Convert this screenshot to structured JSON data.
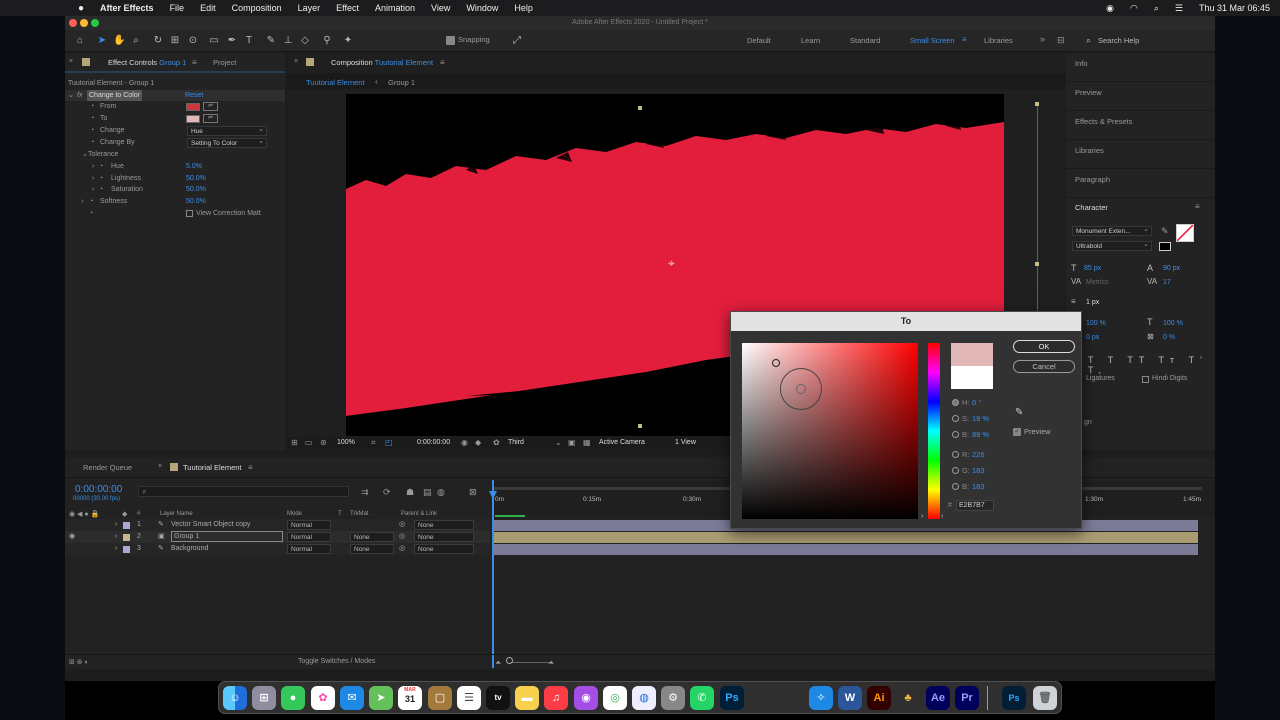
{
  "menubar": {
    "app_name": "After Effects",
    "items": [
      "File",
      "Edit",
      "Composition",
      "Layer",
      "Effect",
      "Animation",
      "View",
      "Window",
      "Help"
    ],
    "clock": "Thu 31 Mar  06:45"
  },
  "window": {
    "title": "Adobe After Effects 2020 - Untitled Project *"
  },
  "toolbar": {
    "snapping_label": "Snapping",
    "workspaces": [
      "Default",
      "Learn",
      "Standard",
      "Small Screen",
      "Libraries"
    ],
    "search_placeholder": "Search Help"
  },
  "effect_controls": {
    "tab_label": "Effect Controls",
    "tab_layer": "Group 1",
    "project_tab": "Project",
    "breadcrumb": "Tuutorial Element - Group 1",
    "effect_name": "Change to Color",
    "reset_label": "Reset",
    "rows": {
      "from": "From",
      "to": "To",
      "change": "Change",
      "change_value": "Hue",
      "change_by": "Change By",
      "change_by_value": "Setting To Color",
      "tolerance": "Tolerance",
      "hue": "Hue",
      "hue_value": "5.0%",
      "lightness": "Lightness",
      "lightness_value": "50.0%",
      "saturation": "Saturation",
      "saturation_value": "50.0%",
      "softness": "Softness",
      "softness_value": "50.0%",
      "view_correction": "View Correction Matt"
    },
    "colors": {
      "from": "#c8383c",
      "to": "#e2b7b7"
    }
  },
  "composition": {
    "tab_prefix": "Composition",
    "tab_name": "Tuutorial Element",
    "breadcrumb_comp": "Tuutorial Element",
    "breadcrumb_layer": "Group 1",
    "footer": {
      "zoom": "100%",
      "timecode": "0:00:00:00",
      "resolution": "Third",
      "camera": "Active Camera",
      "views": "1 View"
    },
    "brush_color": "#e21e3c"
  },
  "right_panel": {
    "items": [
      "Info",
      "Preview",
      "Effects & Presets",
      "Libraries",
      "Paragraph"
    ],
    "character": {
      "title": "Character",
      "font": "Monument Exten...",
      "style": "Ultrabold",
      "font_size": "85 px",
      "leading": "90 px",
      "kerning": "Metrics",
      "tracking": "17",
      "stroke": "1 px",
      "vscale": "100 %",
      "hscale": "100 %",
      "baseline": "0 px",
      "tsume": "0 %",
      "ligatures": "Ligatures",
      "hindi_digits": "Hindi Digits",
      "align_label": "gn"
    }
  },
  "timeline": {
    "render_queue_tab": "Render Queue",
    "comp_tab": "Tuutorial Element",
    "timecode": "0:00:00:00",
    "fps": "00000 (30.00 fps)",
    "col_layer_name": "Layer Name",
    "col_mode": "Mode",
    "col_t": "T",
    "col_trkmat": "TrkMat",
    "col_parent": "Parent & Link",
    "ruler": [
      "0m",
      "0:15m",
      "0:30m",
      "1:30m",
      "1:45m"
    ],
    "layers": [
      {
        "num": "1",
        "name": "Vector Smart Object copy",
        "mode": "Normal",
        "trkmat": "",
        "parent": "None",
        "label_color": "#a9a9d8"
      },
      {
        "num": "2",
        "name": "Group 1",
        "mode": "Normal",
        "trkmat": "None",
        "parent": "None",
        "label_color": "#c9b98a"
      },
      {
        "num": "3",
        "name": "Background",
        "mode": "Normal",
        "trkmat": "None",
        "parent": "None",
        "label_color": "#a9a9d8"
      }
    ],
    "toggle_label": "Toggle Switches / Modes"
  },
  "color_dialog": {
    "title": "To",
    "ok_label": "OK",
    "cancel_label": "Cancel",
    "preview_label": "Preview",
    "h_label": "H:",
    "h_value": "0 °",
    "s_label": "S:",
    "s_value": "19 %",
    "b_label": "B:",
    "b_value": "89 %",
    "r_label": "R:",
    "r_value": "226",
    "g_label": "G:",
    "g_value": "183",
    "bl_label": "B:",
    "bl_value": "183",
    "hex_label": "#",
    "hex_value": "E2B7B7",
    "new_color": "#e2b7b7",
    "old_color": "#ffffff"
  },
  "dock": {
    "calendar_month": "MAR",
    "calendar_day": "31",
    "apps": [
      "Finder",
      "Launchpad",
      "Messages",
      "Photos",
      "Mail",
      "Maps",
      "Calendar",
      "Notes",
      "Reminders",
      "TV",
      "Stickies",
      "Music",
      "Podcasts",
      "Chrome",
      "Safari",
      "System Preferences",
      "WhatsApp",
      "Photoshop",
      "Word",
      "Illustrator",
      "After Effects",
      "Premiere Pro",
      "PSD File",
      "Trash"
    ]
  }
}
